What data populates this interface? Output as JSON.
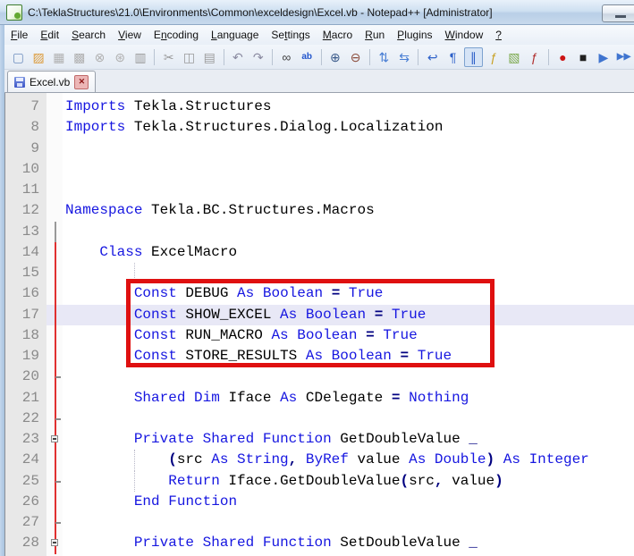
{
  "window": {
    "title": "C:\\TeklaStructures\\21.0\\Environments\\Common\\exceldesign\\Excel.vb - Notepad++ [Administrator]",
    "minimize_label": "minimize"
  },
  "menu": {
    "items": [
      {
        "label": "File",
        "u": 0
      },
      {
        "label": "Edit",
        "u": 0
      },
      {
        "label": "Search",
        "u": 0
      },
      {
        "label": "View",
        "u": 0
      },
      {
        "label": "Encoding",
        "u": 1
      },
      {
        "label": "Language",
        "u": 0
      },
      {
        "label": "Settings",
        "u": 2
      },
      {
        "label": "Macro",
        "u": 0
      },
      {
        "label": "Run",
        "u": 0
      },
      {
        "label": "Plugins",
        "u": 0
      },
      {
        "label": "Window",
        "u": 0
      },
      {
        "label": "?",
        "u": 0
      }
    ]
  },
  "toolbar": {
    "buttons": [
      {
        "type": "btn",
        "name": "new-file-icon",
        "glyph": "▢",
        "color": "#6f8fbf"
      },
      {
        "type": "btn",
        "name": "open-file-icon",
        "glyph": "▨",
        "color": "#dc9b3a"
      },
      {
        "type": "btn",
        "name": "save-icon",
        "glyph": "▦",
        "color": "#b0b0b0"
      },
      {
        "type": "btn",
        "name": "save-all-icon",
        "glyph": "▩",
        "color": "#b0b0b0"
      },
      {
        "type": "btn",
        "name": "close-file-icon",
        "glyph": "⊗",
        "color": "#b0b0b0"
      },
      {
        "type": "btn",
        "name": "close-all-icon",
        "glyph": "⊛",
        "color": "#b0b0b0"
      },
      {
        "type": "btn",
        "name": "print-icon",
        "glyph": "▥",
        "color": "#9a9a9a"
      },
      {
        "type": "sep"
      },
      {
        "type": "btn",
        "name": "cut-icon",
        "glyph": "✂",
        "color": "#9a9a9a"
      },
      {
        "type": "btn",
        "name": "copy-icon",
        "glyph": "◫",
        "color": "#9a9a9a"
      },
      {
        "type": "btn",
        "name": "paste-icon",
        "glyph": "▤",
        "color": "#9a9a9a"
      },
      {
        "type": "sep"
      },
      {
        "type": "btn",
        "name": "undo-icon",
        "glyph": "↶",
        "color": "#8a8aa0"
      },
      {
        "type": "btn",
        "name": "redo-icon",
        "glyph": "↷",
        "color": "#8a8aa0"
      },
      {
        "type": "sep"
      },
      {
        "type": "btn",
        "name": "find-icon",
        "glyph": "∞",
        "color": "#444444"
      },
      {
        "type": "btn",
        "name": "replace-icon",
        "glyph": "ab",
        "color": "#2255cc",
        "small": true
      },
      {
        "type": "sep"
      },
      {
        "type": "btn",
        "name": "zoom-in-icon",
        "glyph": "⊕",
        "color": "#3a5a8a"
      },
      {
        "type": "btn",
        "name": "zoom-out-icon",
        "glyph": "⊖",
        "color": "#8a4a3a"
      },
      {
        "type": "sep"
      },
      {
        "type": "btn",
        "name": "sync-vertical-scroll-icon",
        "glyph": "⇅",
        "color": "#4a7fd4"
      },
      {
        "type": "btn",
        "name": "sync-horizontal-scroll-icon",
        "glyph": "⇆",
        "color": "#4a7fd4"
      },
      {
        "type": "sep"
      },
      {
        "type": "btn",
        "name": "word-wrap-icon",
        "glyph": "↩",
        "color": "#2f62c9"
      },
      {
        "type": "btn",
        "name": "show-all-characters-icon",
        "glyph": "¶",
        "color": "#2f62c9"
      },
      {
        "type": "btn",
        "name": "indent-guide-icon",
        "glyph": "∥",
        "color": "#2f62c9",
        "pressed": true
      },
      {
        "type": "btn",
        "name": "function-calltip-icon",
        "glyph": "ƒ",
        "color": "#c9a227"
      },
      {
        "type": "btn",
        "name": "document-map-icon",
        "glyph": "▧",
        "color": "#7aa84a"
      },
      {
        "type": "btn",
        "name": "function-list-icon",
        "glyph": "ƒ",
        "color": "#b03030"
      },
      {
        "type": "sep"
      },
      {
        "type": "btn",
        "name": "macro-record-icon",
        "glyph": "●",
        "color": "#cc1414"
      },
      {
        "type": "btn",
        "name": "macro-stop-icon",
        "glyph": "■",
        "color": "#202020"
      },
      {
        "type": "btn",
        "name": "macro-play-icon",
        "glyph": "▶",
        "color": "#3f74cf"
      },
      {
        "type": "btn",
        "name": "macro-run-multiple-icon",
        "glyph": "▶▶",
        "color": "#3f74cf",
        "small": true
      }
    ]
  },
  "tabbar": {
    "tabs": [
      {
        "label": "Excel.vb",
        "active": true,
        "saved": true
      }
    ]
  },
  "editor": {
    "current_line": 17,
    "highlight_box": {
      "from_line": 16,
      "to_line": 19
    },
    "lines": [
      {
        "n": 7,
        "t": [
          [
            "k",
            "Imports"
          ],
          [
            "p",
            " Tekla.Structures"
          ]
        ]
      },
      {
        "n": 8,
        "t": [
          [
            "k",
            "Imports"
          ],
          [
            "p",
            " Tekla.Structures.Dialog.Localization"
          ]
        ]
      },
      {
        "n": 9,
        "t": []
      },
      {
        "n": 10,
        "t": []
      },
      {
        "n": 11,
        "t": []
      },
      {
        "n": 12,
        "t": [
          [
            "k",
            "Namespace"
          ],
          [
            "p",
            " Tekla.BC.Structures.Macros"
          ]
        ]
      },
      {
        "n": 13,
        "t": [],
        "f": "gray"
      },
      {
        "n": 14,
        "t": [
          [
            "p",
            "    "
          ],
          [
            "k",
            "Class"
          ],
          [
            "p",
            " ExcelMacro"
          ]
        ],
        "f": "red"
      },
      {
        "n": 15,
        "t": [],
        "f": "red",
        "g": [
          8
        ]
      },
      {
        "n": 16,
        "t": [
          [
            "p",
            "        "
          ],
          [
            "k",
            "Const"
          ],
          [
            "p",
            " DEBUG "
          ],
          [
            "k",
            "As"
          ],
          [
            "p",
            " "
          ],
          [
            "k",
            "Boolean"
          ],
          [
            "p",
            " "
          ],
          [
            "o",
            "="
          ],
          [
            "p",
            " "
          ],
          [
            "k",
            "True"
          ]
        ],
        "f": "red"
      },
      {
        "n": 17,
        "t": [
          [
            "p",
            "        "
          ],
          [
            "k",
            "Const"
          ],
          [
            "p",
            " SHOW_EXCEL "
          ],
          [
            "k",
            "As"
          ],
          [
            "p",
            " "
          ],
          [
            "k",
            "Boolean"
          ],
          [
            "p",
            " "
          ],
          [
            "o",
            "="
          ],
          [
            "p",
            " "
          ],
          [
            "k",
            "True"
          ]
        ],
        "f": "red"
      },
      {
        "n": 18,
        "t": [
          [
            "p",
            "        "
          ],
          [
            "k",
            "Const"
          ],
          [
            "p",
            " RUN_MACRO "
          ],
          [
            "k",
            "As"
          ],
          [
            "p",
            " "
          ],
          [
            "k",
            "Boolean"
          ],
          [
            "p",
            " "
          ],
          [
            "o",
            "="
          ],
          [
            "p",
            " "
          ],
          [
            "k",
            "True"
          ]
        ],
        "f": "red"
      },
      {
        "n": 19,
        "t": [
          [
            "p",
            "        "
          ],
          [
            "k",
            "Const"
          ],
          [
            "p",
            " STORE_RESULTS "
          ],
          [
            "k",
            "As"
          ],
          [
            "p",
            " "
          ],
          [
            "k",
            "Boolean"
          ],
          [
            "p",
            " "
          ],
          [
            "o",
            "="
          ],
          [
            "p",
            " "
          ],
          [
            "k",
            "True"
          ]
        ],
        "f": "red"
      },
      {
        "n": 20,
        "t": [],
        "f": "red",
        "m": "tick"
      },
      {
        "n": 21,
        "t": [
          [
            "p",
            "        "
          ],
          [
            "k",
            "Shared"
          ],
          [
            "p",
            " "
          ],
          [
            "k",
            "Dim"
          ],
          [
            "p",
            " Iface "
          ],
          [
            "k",
            "As"
          ],
          [
            "p",
            " CDelegate "
          ],
          [
            "o",
            "="
          ],
          [
            "p",
            " "
          ],
          [
            "k",
            "Nothing"
          ]
        ],
        "f": "red"
      },
      {
        "n": 22,
        "t": [],
        "f": "red",
        "m": "tick"
      },
      {
        "n": 23,
        "t": [
          [
            "p",
            "        "
          ],
          [
            "k",
            "Private"
          ],
          [
            "p",
            " "
          ],
          [
            "k",
            "Shared"
          ],
          [
            "p",
            " "
          ],
          [
            "k",
            "Function"
          ],
          [
            "p",
            " GetDoubleValue "
          ],
          [
            "o",
            "_"
          ]
        ],
        "f": "red",
        "m": "box"
      },
      {
        "n": 24,
        "t": [
          [
            "p",
            "            "
          ],
          [
            "o",
            "("
          ],
          [
            "p",
            "src "
          ],
          [
            "k",
            "As"
          ],
          [
            "p",
            " "
          ],
          [
            "k",
            "String"
          ],
          [
            "o",
            ","
          ],
          [
            "p",
            " "
          ],
          [
            "k",
            "ByRef"
          ],
          [
            "p",
            " value "
          ],
          [
            "k",
            "As"
          ],
          [
            "p",
            " "
          ],
          [
            "k",
            "Double"
          ],
          [
            "o",
            ")"
          ],
          [
            "p",
            " "
          ],
          [
            "k",
            "As"
          ],
          [
            "p",
            " "
          ],
          [
            "k",
            "Integer"
          ]
        ],
        "f": "red",
        "g": [
          8
        ]
      },
      {
        "n": 25,
        "t": [
          [
            "p",
            "            "
          ],
          [
            "k",
            "Return"
          ],
          [
            "p",
            " Iface.GetDoubleValue"
          ],
          [
            "o",
            "("
          ],
          [
            "p",
            "src"
          ],
          [
            "o",
            ","
          ],
          [
            "p",
            " value"
          ],
          [
            "o",
            ")"
          ]
        ],
        "f": "red",
        "m": "tick",
        "g": [
          8
        ]
      },
      {
        "n": 26,
        "t": [
          [
            "p",
            "        "
          ],
          [
            "k",
            "End"
          ],
          [
            "p",
            " "
          ],
          [
            "k",
            "Function"
          ]
        ],
        "f": "red"
      },
      {
        "n": 27,
        "t": [],
        "f": "red",
        "m": "tick"
      },
      {
        "n": 28,
        "t": [
          [
            "p",
            "        "
          ],
          [
            "k",
            "Private"
          ],
          [
            "p",
            " "
          ],
          [
            "k",
            "Shared"
          ],
          [
            "p",
            " "
          ],
          [
            "k",
            "Function"
          ],
          [
            "p",
            " SetDoubleValue "
          ],
          [
            "o",
            "_"
          ]
        ],
        "f": "red",
        "m": "box"
      }
    ]
  },
  "colors": {
    "keyword": "#1616e0",
    "operator": "#000080",
    "plain": "#000000",
    "line_number": "#8a8a8a",
    "gutter_bg": "#e8e8e8",
    "current_line_highlight": "#e8e8f6",
    "fold_line_red": "#e03030",
    "annotation_box_red": "#df1010",
    "titlebar_blue": "#c7d9ec"
  }
}
